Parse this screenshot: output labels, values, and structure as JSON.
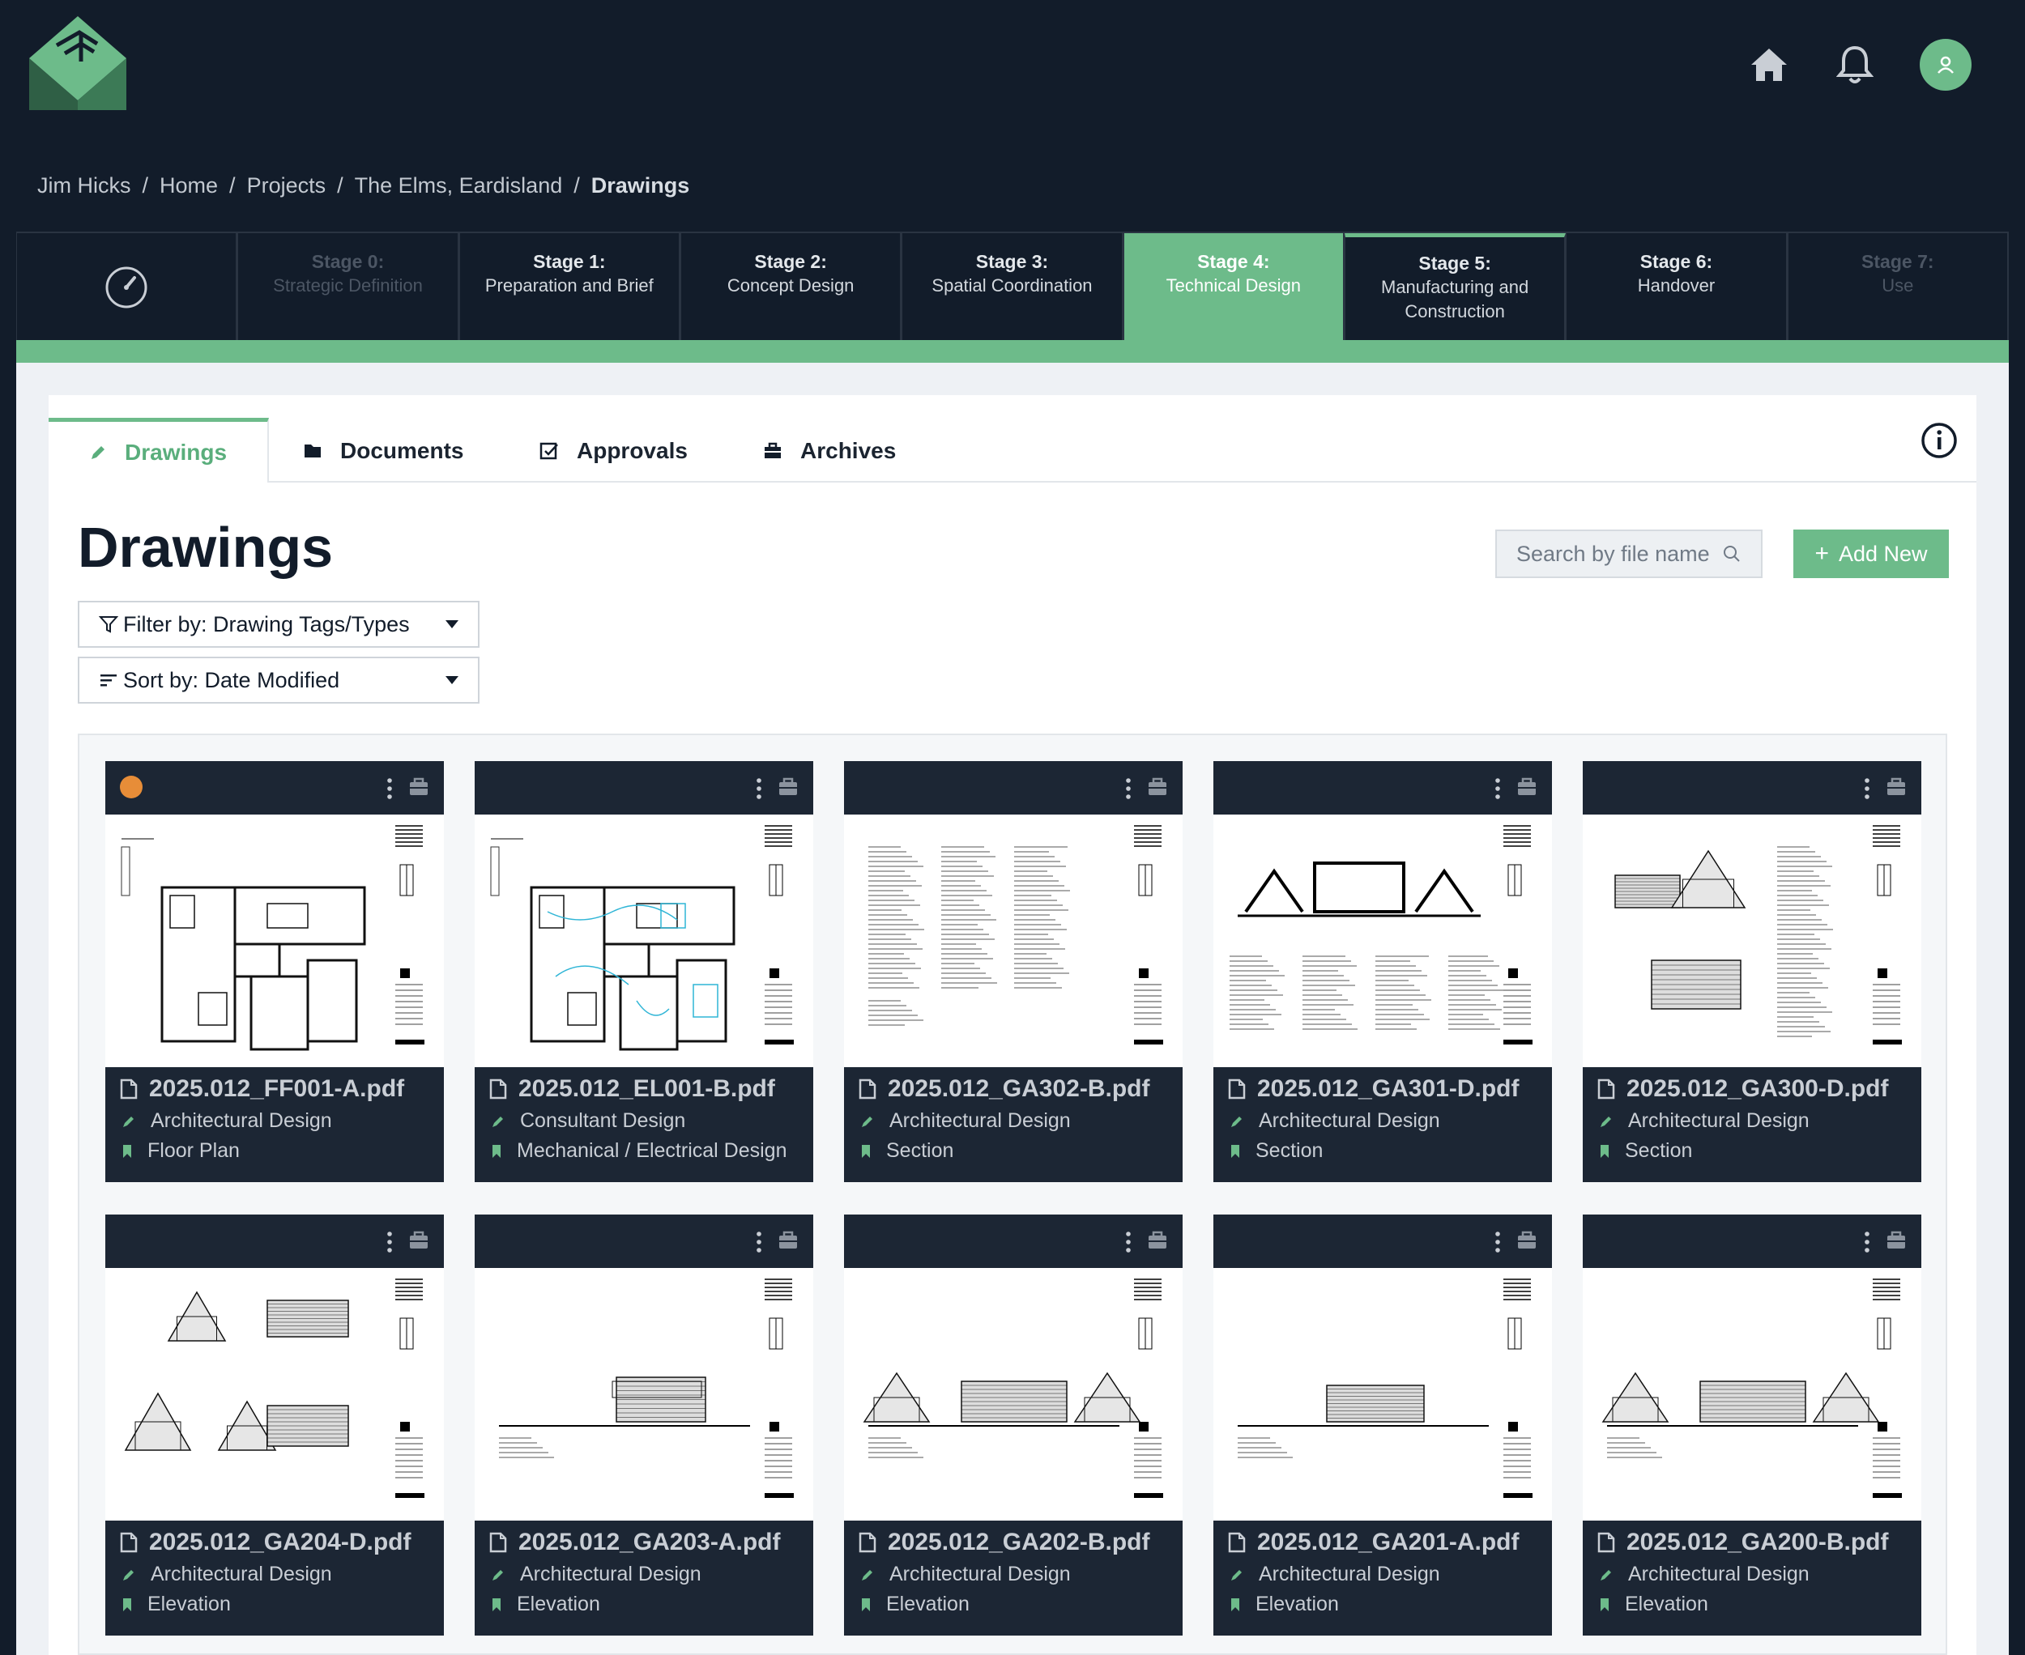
{
  "breadcrumb": [
    "Jim Hicks",
    "Home",
    "Projects",
    "The Elms, Eardisland",
    "Drawings"
  ],
  "stages": [
    {
      "num": "Stage 0:",
      "name": "Strategic Definition",
      "state": "muted"
    },
    {
      "num": "Stage 1:",
      "name": "Preparation and Brief",
      "state": "normal"
    },
    {
      "num": "Stage 2:",
      "name": "Concept Design",
      "state": "normal"
    },
    {
      "num": "Stage 3:",
      "name": "Spatial Coordination",
      "state": "normal"
    },
    {
      "num": "Stage 4:",
      "name": "Technical Design",
      "state": "active"
    },
    {
      "num": "Stage 5:",
      "name": "Manufacturing and Construction",
      "state": "next"
    },
    {
      "num": "Stage 6:",
      "name": "Handover",
      "state": "normal"
    },
    {
      "num": "Stage 7:",
      "name": "Use",
      "state": "muted"
    }
  ],
  "tabs": {
    "drawings": "Drawings",
    "documents": "Documents",
    "approvals": "Approvals",
    "archives": "Archives"
  },
  "page": {
    "title": "Drawings"
  },
  "search": {
    "placeholder": "Search by file name"
  },
  "add_button": "Add New",
  "filter": {
    "label": "Filter by: Drawing Tags/Types"
  },
  "sort": {
    "label": "Sort by: Date Modified"
  },
  "colors": {
    "accent": "#6dbb8a",
    "dark": "#121c2a",
    "card": "#1c2634",
    "status_dot": "#e78d38"
  },
  "drawings": [
    {
      "file": "2025.012_FF001-A.pdf",
      "discipline": "Architectural Design",
      "type": "Floor Plan",
      "thumb": "plan",
      "dot": true
    },
    {
      "file": "2025.012_EL001-B.pdf",
      "discipline": "Consultant Design",
      "type": "Mechanical / Electrical Design",
      "thumb": "plan-elec",
      "dot": false
    },
    {
      "file": "2025.012_GA302-B.pdf",
      "discipline": "Architectural Design",
      "type": "Section",
      "thumb": "text",
      "dot": false
    },
    {
      "file": "2025.012_GA301-D.pdf",
      "discipline": "Architectural Design",
      "type": "Section",
      "thumb": "section",
      "dot": false
    },
    {
      "file": "2025.012_GA300-D.pdf",
      "discipline": "Architectural Design",
      "type": "Section",
      "thumb": "section2",
      "dot": false
    },
    {
      "file": "2025.012_GA204-D.pdf",
      "discipline": "Architectural Design",
      "type": "Elevation",
      "thumb": "elev-multi",
      "dot": false
    },
    {
      "file": "2025.012_GA203-A.pdf",
      "discipline": "Architectural Design",
      "type": "Elevation",
      "thumb": "elev-a",
      "dot": false
    },
    {
      "file": "2025.012_GA202-B.pdf",
      "discipline": "Architectural Design",
      "type": "Elevation",
      "thumb": "elev-b",
      "dot": false
    },
    {
      "file": "2025.012_GA201-A.pdf",
      "discipline": "Architectural Design",
      "type": "Elevation",
      "thumb": "elev-c",
      "dot": false
    },
    {
      "file": "2025.012_GA200-B.pdf",
      "discipline": "Architectural Design",
      "type": "Elevation",
      "thumb": "elev-b",
      "dot": false
    }
  ]
}
